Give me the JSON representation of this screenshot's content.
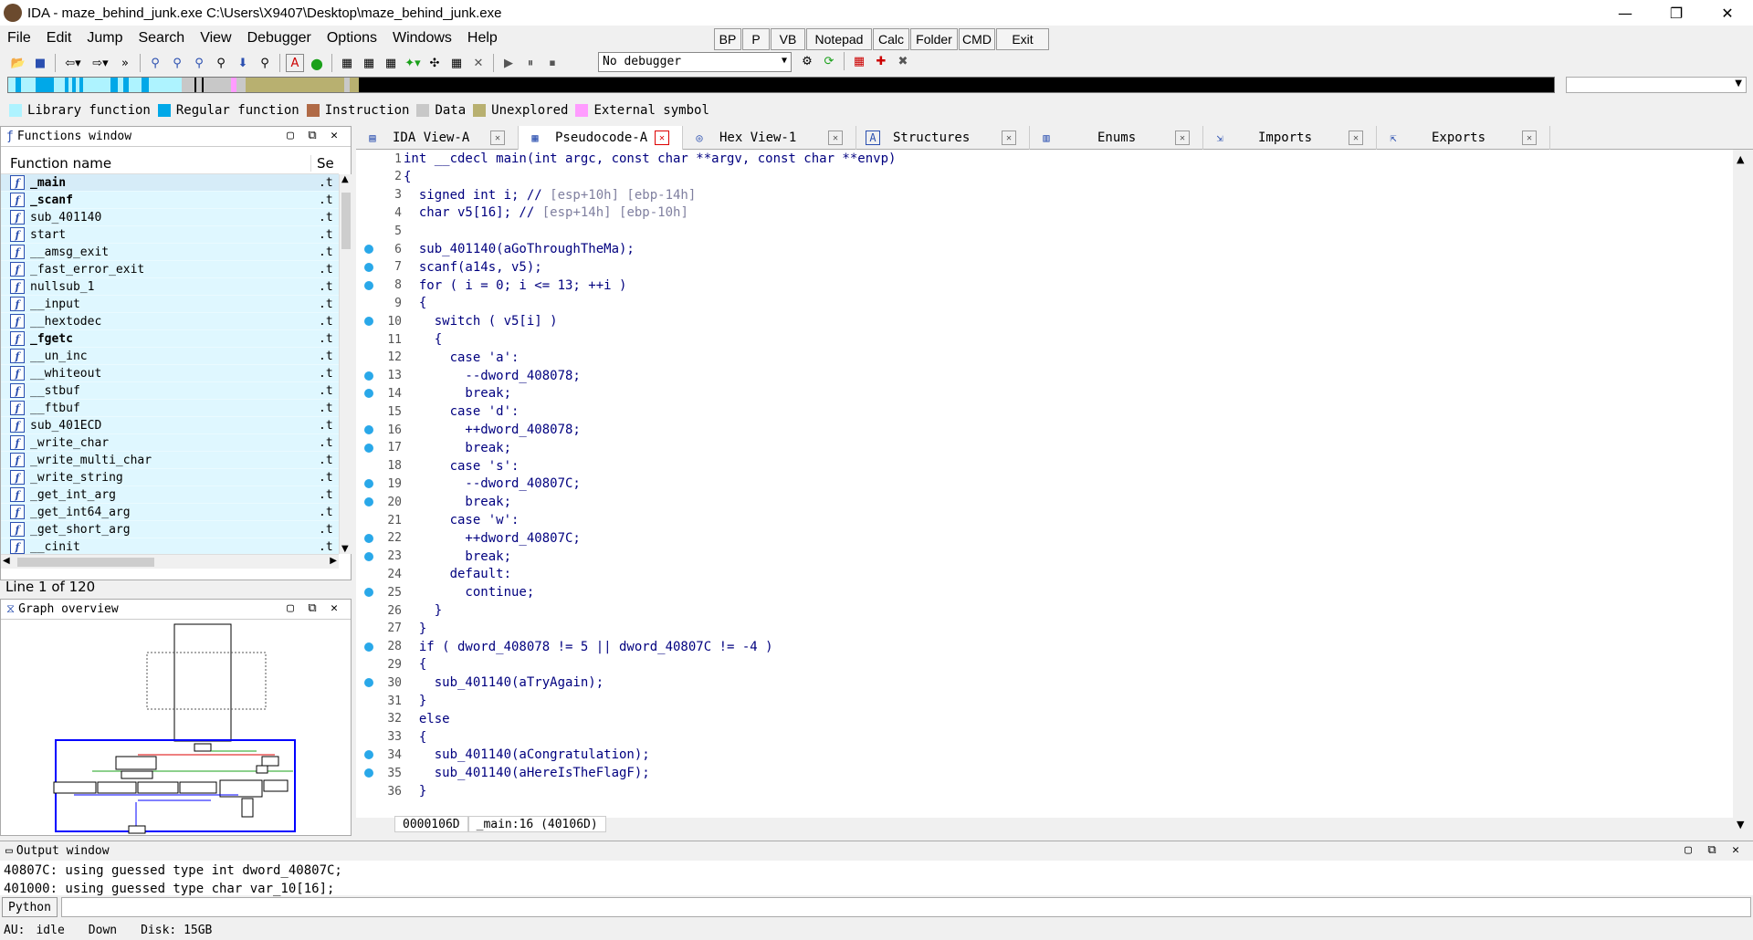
{
  "window": {
    "title": "IDA - maze_behind_junk.exe C:\\Users\\X9407\\Desktop\\maze_behind_junk.exe",
    "minimize": "—",
    "maximize": "❐",
    "close": "✕"
  },
  "menu": [
    "File",
    "Edit",
    "Jump",
    "Search",
    "View",
    "Debugger",
    "Options",
    "Windows",
    "Help"
  ],
  "quick_buttons": [
    "BP",
    "P",
    "VB",
    "Notepad",
    "Calc",
    "Folder",
    "CMD",
    "Exit"
  ],
  "debugger_select": "No debugger",
  "legend": [
    {
      "label": "Library function",
      "color": "#aef3ff"
    },
    {
      "label": "Regular function",
      "color": "#00a8e8"
    },
    {
      "label": "Instruction",
      "color": "#b06a46"
    },
    {
      "label": "Data",
      "color": "#c8c8c8"
    },
    {
      "label": "Unexplored",
      "color": "#b8b070"
    },
    {
      "label": "External symbol",
      "color": "#ff9cff"
    }
  ],
  "functions_window": {
    "title": "Functions window",
    "col_name": "Function name",
    "col_seg": "Se",
    "items": [
      {
        "name": "_main",
        "bold": true,
        "seg": ".t"
      },
      {
        "name": "_scanf",
        "bold": true,
        "seg": ".t"
      },
      {
        "name": "sub_401140",
        "bold": false,
        "seg": ".t"
      },
      {
        "name": "start",
        "bold": false,
        "seg": ".t"
      },
      {
        "name": "__amsg_exit",
        "bold": false,
        "seg": ".t"
      },
      {
        "name": "_fast_error_exit",
        "bold": false,
        "seg": ".t"
      },
      {
        "name": "nullsub_1",
        "bold": false,
        "seg": ".t"
      },
      {
        "name": "__input",
        "bold": false,
        "seg": ".t"
      },
      {
        "name": "__hextodec",
        "bold": false,
        "seg": ".t"
      },
      {
        "name": "_fgetc",
        "bold": true,
        "seg": ".t"
      },
      {
        "name": "__un_inc",
        "bold": false,
        "seg": ".t"
      },
      {
        "name": "__whiteout",
        "bold": false,
        "seg": ".t"
      },
      {
        "name": "__stbuf",
        "bold": false,
        "seg": ".t"
      },
      {
        "name": "__ftbuf",
        "bold": false,
        "seg": ".t"
      },
      {
        "name": "sub_401ECD",
        "bold": false,
        "seg": ".t"
      },
      {
        "name": "_write_char",
        "bold": false,
        "seg": ".t"
      },
      {
        "name": "_write_multi_char",
        "bold": false,
        "seg": ".t"
      },
      {
        "name": "_write_string",
        "bold": false,
        "seg": ".t"
      },
      {
        "name": "_get_int_arg",
        "bold": false,
        "seg": ".t"
      },
      {
        "name": "_get_int64_arg",
        "bold": false,
        "seg": ".t"
      },
      {
        "name": "_get_short_arg",
        "bold": false,
        "seg": ".t"
      },
      {
        "name": "__cinit",
        "bold": false,
        "seg": ".t"
      }
    ],
    "line_status": "Line 1 of 120"
  },
  "graph_overview": {
    "title": "Graph overview"
  },
  "tabs": [
    {
      "label": "IDA View-A",
      "icon": "▤",
      "active": false
    },
    {
      "label": "Pseudocode-A",
      "icon": "▦",
      "active": true
    },
    {
      "label": "Hex View-1",
      "icon": "◎",
      "active": false
    },
    {
      "label": "Structures",
      "icon": "A",
      "active": false
    },
    {
      "label": "Enums",
      "icon": "▥",
      "active": false
    },
    {
      "label": "Imports",
      "icon": "⇲",
      "active": false
    },
    {
      "label": "Exports",
      "icon": "⇱",
      "active": false
    }
  ],
  "code": [
    {
      "n": "1",
      "bp": false,
      "text": "int __cdecl main(int argc, const char **argv, const char **envp)"
    },
    {
      "n": "2",
      "bp": false,
      "text": "{"
    },
    {
      "n": "3",
      "bp": false,
      "text": "  signed int i; // [esp+10h] [ebp-14h]"
    },
    {
      "n": "4",
      "bp": false,
      "text": "  char v5[16]; // [esp+14h] [ebp-10h]"
    },
    {
      "n": "5",
      "bp": false,
      "text": ""
    },
    {
      "n": "6",
      "bp": true,
      "text": "  sub_401140(aGoThroughTheMa);"
    },
    {
      "n": "7",
      "bp": true,
      "text": "  scanf(a14s, v5);"
    },
    {
      "n": "8",
      "bp": true,
      "text": "  for ( i = 0; i <= 13; ++i )"
    },
    {
      "n": "9",
      "bp": false,
      "text": "  {"
    },
    {
      "n": "10",
      "bp": true,
      "text": "    switch ( v5[i] )"
    },
    {
      "n": "11",
      "bp": false,
      "text": "    {"
    },
    {
      "n": "12",
      "bp": false,
      "text": "      case 'a':"
    },
    {
      "n": "13",
      "bp": true,
      "text": "        --dword_408078;"
    },
    {
      "n": "14",
      "bp": true,
      "text": "        break;"
    },
    {
      "n": "15",
      "bp": false,
      "text": "      case 'd':"
    },
    {
      "n": "16",
      "bp": true,
      "text": "        ++dword_408078;"
    },
    {
      "n": "17",
      "bp": true,
      "text": "        break;"
    },
    {
      "n": "18",
      "bp": false,
      "text": "      case 's':"
    },
    {
      "n": "19",
      "bp": true,
      "text": "        --dword_40807C;"
    },
    {
      "n": "20",
      "bp": true,
      "text": "        break;"
    },
    {
      "n": "21",
      "bp": false,
      "text": "      case 'w':"
    },
    {
      "n": "22",
      "bp": true,
      "text": "        ++dword_40807C;"
    },
    {
      "n": "23",
      "bp": true,
      "text": "        break;"
    },
    {
      "n": "24",
      "bp": false,
      "text": "      default:"
    },
    {
      "n": "25",
      "bp": true,
      "text": "        continue;"
    },
    {
      "n": "26",
      "bp": false,
      "text": "    }"
    },
    {
      "n": "27",
      "bp": false,
      "text": "  }"
    },
    {
      "n": "28",
      "bp": true,
      "text": "  if ( dword_408078 != 5 || dword_40807C != -4 )"
    },
    {
      "n": "29",
      "bp": false,
      "text": "  {"
    },
    {
      "n": "30",
      "bp": true,
      "text": "    sub_401140(aTryAgain);"
    },
    {
      "n": "31",
      "bp": false,
      "text": "  }"
    },
    {
      "n": "32",
      "bp": false,
      "text": "  else"
    },
    {
      "n": "33",
      "bp": false,
      "text": "  {"
    },
    {
      "n": "34",
      "bp": true,
      "text": "    sub_401140(aCongratulation);"
    },
    {
      "n": "35",
      "bp": true,
      "text": "    sub_401140(aHereIsTheFlagF);"
    },
    {
      "n": "36",
      "bp": false,
      "text": "  }"
    }
  ],
  "editor_status": [
    "0000106D",
    "_main:16 (40106D)"
  ],
  "output": {
    "title": "Output window",
    "lines": [
      "40807C: using guessed type int dword_40807C;",
      "401000: using guessed type char var_10[16];"
    ]
  },
  "python_button": "Python",
  "statusbar": [
    "AU:",
    "idle",
    "Down",
    "Disk: 15GB"
  ]
}
